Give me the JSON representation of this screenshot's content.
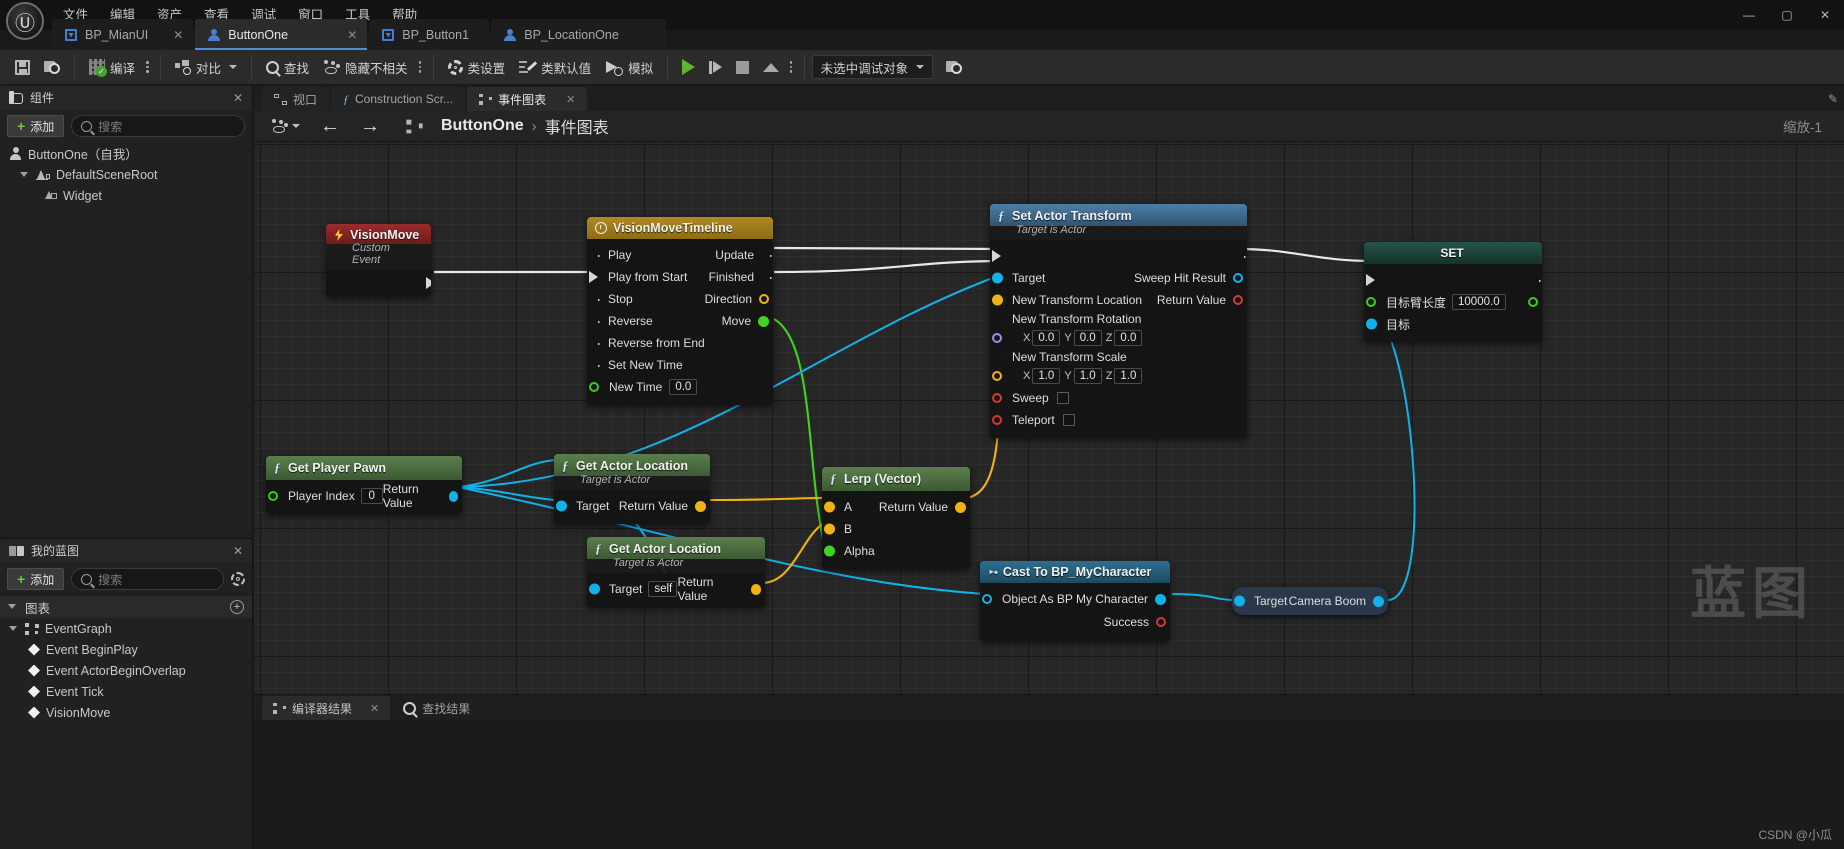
{
  "window": {
    "menus": [
      "文件",
      "编辑",
      "资产",
      "查看",
      "调试",
      "窗口",
      "工具",
      "帮助"
    ],
    "controls": {
      "minimize": "—",
      "maximize": "▢",
      "close": "✕"
    }
  },
  "asset_tabs": [
    {
      "label": "BP_MianUI",
      "icon": "widget-blueprint-icon",
      "active": false,
      "close": "✕"
    },
    {
      "label": "ButtonOne",
      "icon": "actor-blueprint-icon",
      "active": true,
      "close": "✕"
    },
    {
      "label": "BP_Button1",
      "icon": "widget-blueprint-icon",
      "active": false,
      "close": "✕"
    },
    {
      "label": "BP_LocationOne",
      "icon": "actor-blueprint-icon",
      "active": false,
      "close": "✕"
    }
  ],
  "toolbar": {
    "save": "",
    "browse": "",
    "compile": "编译",
    "diff": "对比",
    "find": "查找",
    "hide_unrelated": "隐藏不相关",
    "class_settings": "类设置",
    "class_defaults": "类默认值",
    "simulate": "模拟",
    "debug_object": "未选中调试对象"
  },
  "components_panel": {
    "title": "组件",
    "close": "✕",
    "add_label": "添加",
    "search_placeholder": "搜索",
    "tree": [
      {
        "label": "ButtonOne（自我）",
        "icon": "actor-icon",
        "depth": 0,
        "expandable": false
      },
      {
        "label": "DefaultSceneRoot",
        "icon": "scene-root-icon",
        "depth": 1,
        "expandable": true
      },
      {
        "label": "Widget",
        "icon": "widget-component-icon",
        "depth": 2,
        "expandable": false
      }
    ]
  },
  "myblueprint_panel": {
    "title": "我的蓝图",
    "close": "✕",
    "add_label": "添加",
    "search_placeholder": "搜索",
    "settings_icon": "gear-icon",
    "sections": [
      {
        "label": "图表",
        "add_icon": "plus-circle-icon",
        "items": [
          {
            "label": "EventGraph",
            "icon": "graph-icon",
            "depth": 1
          },
          {
            "label": "Event BeginPlay",
            "icon": "event-icon",
            "depth": 2
          },
          {
            "label": "Event ActorBeginOverlap",
            "icon": "event-icon",
            "depth": 2
          },
          {
            "label": "Event Tick",
            "icon": "event-icon",
            "depth": 2
          },
          {
            "label": "VisionMove",
            "icon": "event-icon",
            "depth": 2
          }
        ]
      }
    ]
  },
  "graph_tabs": [
    {
      "label": "视口",
      "icon": "viewport-icon",
      "active": false
    },
    {
      "label": "Construction Scr...",
      "icon": "function-icon",
      "active": false
    },
    {
      "label": "事件图表",
      "icon": "eventgraph-icon",
      "active": true,
      "close": "✕"
    }
  ],
  "graph_toolbar": {
    "back_icon": "arrow-left-icon",
    "forward_icon": "arrow-right-icon",
    "hide_icon": "hide-unrelated-icon",
    "graph_icon": "eventgraph-icon",
    "breadcrumb_root": "ButtonOne",
    "breadcrumb_sep": "›",
    "breadcrumb_current": "事件图表",
    "zoom_label": "缩放-1"
  },
  "nodes": {
    "custom_event": {
      "title": "VisionMove",
      "subtitle": "Custom Event",
      "icon": "bolt-icon"
    },
    "timeline": {
      "title": "VisionMoveTimeline",
      "icon": "clock-icon",
      "inputs": [
        "Play",
        "Play from Start",
        "Stop",
        "Reverse",
        "Reverse from End",
        "Set New Time"
      ],
      "new_time_label": "New Time",
      "new_time_value": "0.0",
      "outputs": [
        "Update",
        "Finished",
        "Direction",
        "Move"
      ]
    },
    "set_actor_transform": {
      "title": "Set Actor Transform",
      "subtitle": "Target is Actor",
      "icon": "function-icon",
      "target_label": "Target",
      "sweep_hit_label": "Sweep Hit Result",
      "new_transform_location": "New Transform Location",
      "return_value": "Return Value",
      "new_transform_rotation": "New Transform Rotation",
      "rotation": {
        "x": "0.0",
        "y": "0.0",
        "z": "0.0"
      },
      "new_transform_scale": "New Transform Scale",
      "scale": {
        "x": "1.0",
        "y": "1.0",
        "z": "1.0"
      },
      "sweep_label": "Sweep",
      "teleport_label": "Teleport",
      "axis_x": "X",
      "axis_y": "Y",
      "axis_z": "Z"
    },
    "set_node": {
      "title": "SET",
      "var_label": "目标臂长度",
      "var_value": "10000.0",
      "target_label": "目标"
    },
    "get_player_pawn": {
      "title": "Get Player Pawn",
      "icon": "function-icon",
      "player_index_label": "Player Index",
      "player_index_value": "0",
      "return_value": "Return Value"
    },
    "get_actor_location_1": {
      "title": "Get Actor Location",
      "subtitle": "Target is Actor",
      "icon": "function-icon",
      "target_label": "Target",
      "return_value": "Return Value"
    },
    "get_actor_location_2": {
      "title": "Get Actor Location",
      "subtitle": "Target is Actor",
      "icon": "function-icon",
      "target_label": "Target",
      "target_value": "self",
      "return_value": "Return Value"
    },
    "lerp_vector": {
      "title": "Lerp (Vector)",
      "icon": "function-icon",
      "a_label": "A",
      "b_label": "B",
      "alpha_label": "Alpha",
      "return_value": "Return Value"
    },
    "cast_node": {
      "title": "Cast To BP_MyCharacter",
      "icon": "cast-icon",
      "object_label": "Object",
      "as_label": "As BP My Character",
      "success_label": "Success"
    },
    "camera_boom": {
      "target_label": "Target",
      "value_label": "Camera Boom"
    }
  },
  "bottom_bar": {
    "tabs": [
      {
        "label": "编译器结果",
        "icon": "compiler-icon",
        "active": true,
        "close": "✕"
      },
      {
        "label": "查找结果",
        "icon": "search-icon",
        "active": false
      }
    ]
  },
  "watermark": "蓝图",
  "credit": "CSDN @小瓜",
  "colors": {
    "exec_wire": "#e8e8e8",
    "object_wire": "#12b1e8",
    "vector_wire": "#efb411",
    "float_wire": "#3fd41f",
    "accent_blue": "#4e8ed8",
    "compile_green": "#4aa832",
    "play_green": "#5fb52b"
  }
}
